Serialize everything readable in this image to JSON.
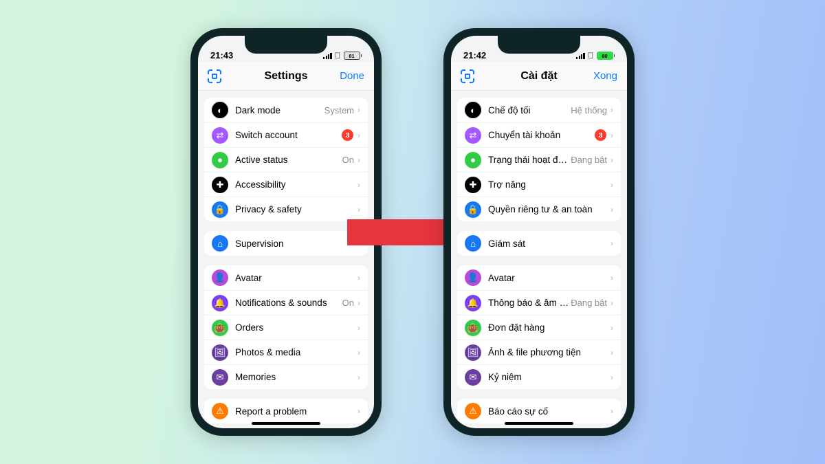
{
  "left": {
    "time": "21:43",
    "battery": "81",
    "title": "Settings",
    "done": "Done",
    "group1": [
      {
        "icon": "moon",
        "color": "c-black",
        "label": "Dark mode",
        "value": "System",
        "badge": null
      },
      {
        "icon": "switch",
        "color": "c-purple",
        "label": "Switch account",
        "value": "",
        "badge": "3"
      },
      {
        "icon": "status",
        "color": "c-green",
        "label": "Active status",
        "value": "On",
        "badge": null
      },
      {
        "icon": "access",
        "color": "c-black",
        "label": "Accessibility",
        "value": "",
        "badge": null
      },
      {
        "icon": "lock",
        "color": "c-blue",
        "label": "Privacy & safety",
        "value": "",
        "badge": null
      }
    ],
    "group2": [
      {
        "icon": "home",
        "color": "c-blue",
        "label": "Supervision",
        "value": "",
        "badge": null
      }
    ],
    "group3": [
      {
        "icon": "avatar",
        "color": "c-pink",
        "label": "Avatar",
        "value": "",
        "badge": null
      },
      {
        "icon": "bell",
        "color": "c-violet",
        "label": "Notifications & sounds",
        "value": "On",
        "badge": null
      },
      {
        "icon": "bag",
        "color": "c-green",
        "label": "Orders",
        "value": "",
        "badge": null
      },
      {
        "icon": "photo",
        "color": "c-darkpurple",
        "label": "Photos & media",
        "value": "",
        "badge": null
      },
      {
        "icon": "mem",
        "color": "c-darkpurple",
        "label": "Memories",
        "value": "",
        "badge": null
      }
    ],
    "group4": [
      {
        "icon": "warn",
        "color": "c-orange",
        "label": "Report a problem",
        "value": "",
        "badge": null
      }
    ]
  },
  "right": {
    "time": "21:42",
    "battery": "80",
    "title": "Cài đặt",
    "done": "Xong",
    "group1": [
      {
        "icon": "moon",
        "color": "c-black",
        "label": "Chế độ tối",
        "value": "Hệ thống",
        "badge": null
      },
      {
        "icon": "switch",
        "color": "c-purple",
        "label": "Chuyển tài khoản",
        "value": "",
        "badge": "3"
      },
      {
        "icon": "status",
        "color": "c-green",
        "label": "Trạng thái hoạt động",
        "value": "Đang bật",
        "badge": null
      },
      {
        "icon": "access",
        "color": "c-black",
        "label": "Trợ năng",
        "value": "",
        "badge": null
      },
      {
        "icon": "lock",
        "color": "c-blue",
        "label": "Quyền riêng tư & an toàn",
        "value": "",
        "badge": null
      }
    ],
    "group2": [
      {
        "icon": "home",
        "color": "c-blue",
        "label": "Giám sát",
        "value": "",
        "badge": null
      }
    ],
    "group3": [
      {
        "icon": "avatar",
        "color": "c-pink",
        "label": "Avatar",
        "value": "",
        "badge": null
      },
      {
        "icon": "bell",
        "color": "c-violet",
        "label": "Thông báo & âm thanh",
        "value": "Đang bật",
        "badge": null
      },
      {
        "icon": "bag",
        "color": "c-green",
        "label": "Đơn đặt hàng",
        "value": "",
        "badge": null
      },
      {
        "icon": "photo",
        "color": "c-darkpurple",
        "label": "Ảnh & file phương tiện",
        "value": "",
        "badge": null
      },
      {
        "icon": "mem",
        "color": "c-darkpurple",
        "label": "Kỷ niệm",
        "value": "",
        "badge": null
      }
    ],
    "group4": [
      {
        "icon": "warn",
        "color": "c-orange",
        "label": "Báo cáo sự cố",
        "value": "",
        "badge": null
      }
    ]
  },
  "icons": {
    "moon": "◐",
    "switch": "⇄",
    "status": "●",
    "access": "✚",
    "lock": "🔒",
    "home": "⌂",
    "avatar": "👤",
    "bell": "🔔",
    "bag": "👜",
    "photo": "🖼",
    "mem": "✉",
    "warn": "⚠"
  }
}
